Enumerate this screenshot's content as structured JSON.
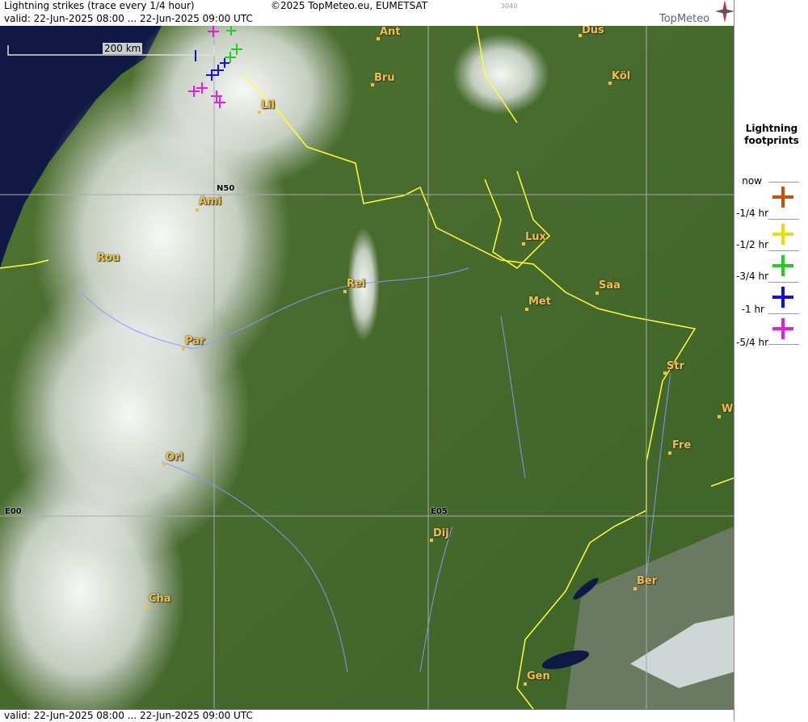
{
  "header": {
    "title": "Lightning strikes (trace every 1/4 hour)",
    "copyright": "©2025 TopMeteo.eu, EUMETSAT",
    "code": "3040",
    "valid": "valid:  22-Jun-2025 08:00 ... 22-Jun-2025 09:00 UTC",
    "logo": "TopMeteo"
  },
  "footer": {
    "valid": "valid:  22-Jun-2025 08:00 ... 22-Jun-2025 09:00 UTC"
  },
  "scale": {
    "label": "200 km"
  },
  "grid_labels": {
    "lat": "N50",
    "lon0": "E00",
    "lon5": "E05"
  },
  "cities": {
    "ant": "Ant",
    "dus": "Düs",
    "bru": "Bru",
    "kol": "Köl",
    "lil": "Lil",
    "ami": "Ami",
    "lux": "Lux",
    "rou": "Rou",
    "rei": "Rei",
    "saa": "Saa",
    "met": "Met",
    "par": "Par",
    "str": "Str",
    "w": "W",
    "fre": "Fre",
    "orl": "Orl",
    "dij": "Dij",
    "ber": "Ber",
    "cha": "Cha",
    "gen": "Gen"
  },
  "legend": {
    "title_line1": "Lightning",
    "title_line2": "footprints",
    "rows": [
      {
        "label": "now",
        "color": "#c85010"
      },
      {
        "label": "-1/4 hr",
        "color": "#e8e000"
      },
      {
        "label": "-1/2 hr",
        "color": "#20d020"
      },
      {
        "label": "-3/4 hr",
        "color": "#1010e0"
      },
      {
        "label": "-1 hr",
        "color": "#e020e0"
      },
      {
        "label": "-5/4 hr",
        "color": ""
      }
    ]
  },
  "colors": {
    "land": "#4a6e2e",
    "sea": "#101840",
    "border": "#ffff33",
    "river": "#8899ff",
    "city": "#f0c040"
  }
}
